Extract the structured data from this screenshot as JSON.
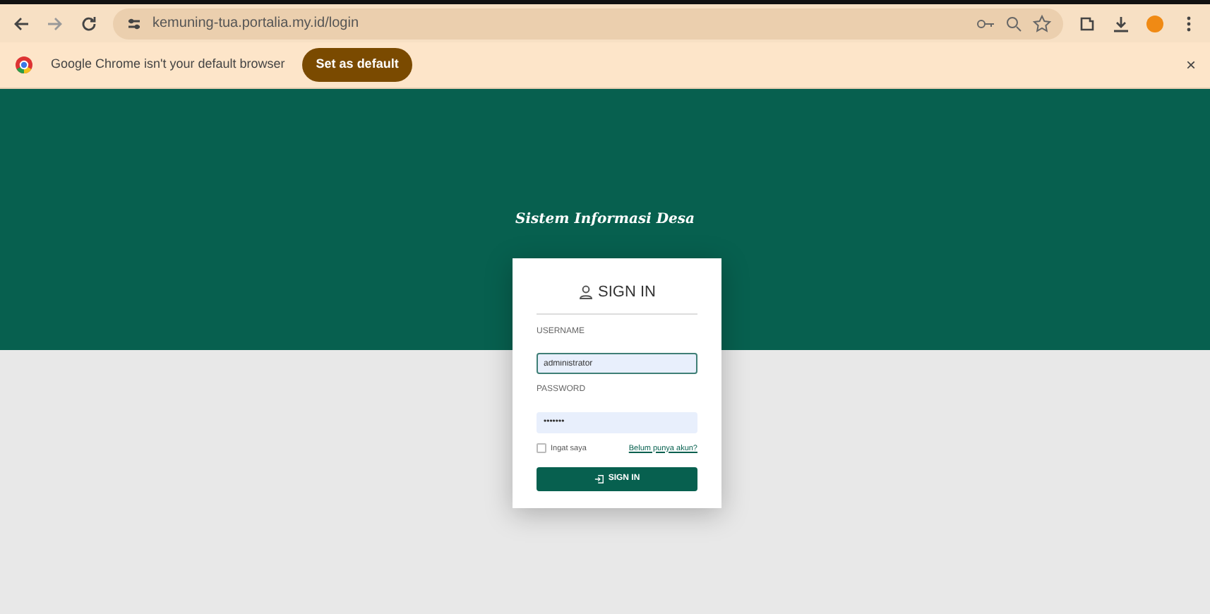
{
  "browser": {
    "url": "kemuning-tua.portalia.my.id/login"
  },
  "infobar": {
    "message": "Google Chrome isn't your default browser",
    "button": "Set as default",
    "close": "×"
  },
  "site_title": "Sistem Informasi Desa",
  "login": {
    "heading": "SIGN IN",
    "username": {
      "label": "USERNAME",
      "value": "administrator"
    },
    "password": {
      "label": "PASSWORD",
      "value": "•••••••"
    },
    "remember": {
      "label": "Ingat saya",
      "checked": false
    },
    "register_link": "Belum punya akun?",
    "submit": "SIGN IN"
  }
}
